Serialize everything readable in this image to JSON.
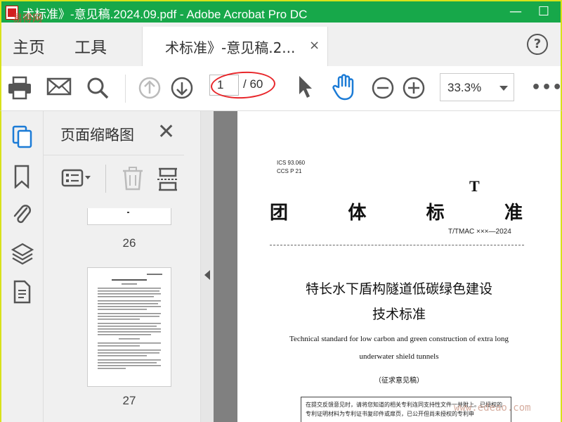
{
  "window": {
    "title": "术标准》-意见稿.2024.09.pdf - Adobe Acrobat Pro DC",
    "watermark_top": "易得网",
    "minimize": "—",
    "maximize": "☐"
  },
  "tabs": {
    "home": "主页",
    "tools": "工具",
    "document_tab": "术标准》-意见稿.2...",
    "close": "×",
    "help": "?"
  },
  "toolbar": {
    "current_page": "1",
    "total_pages": "/ 60",
    "zoom": "33.3%",
    "more": "•••"
  },
  "thumbnail_panel": {
    "title": "页面缩略图",
    "close": "✕",
    "pages": [
      {
        "label": "26"
      },
      {
        "label": "27"
      }
    ]
  },
  "document": {
    "ics": "ICS 93.060",
    "ccs": "CCS P 21",
    "t_letter": "T",
    "heading_chars": [
      "团",
      "体",
      "标",
      "准"
    ],
    "standard_no": "T/TMAC ×××—2024",
    "title_cn_line1": "特长水下盾构隧道低碳绿色建设",
    "title_cn_line2": "技术标准",
    "title_en_line1": "Technical standard for low carbon and green construction of extra long",
    "title_en_line2": "underwater shield tunnels",
    "draft_note": "（征求意见稿）",
    "notice_text": "在提交反馈意见时，请将您知道的相关专利连同支持性文件一并附上。已授权的专利证明材料为专利证书复印件或扉页，已公开但尚未授权的专利申"
  },
  "watermark_bottom": "www.edeao.com",
  "colors": {
    "titlebar": "#17a84a",
    "border_highlight": "#d8e21a",
    "annotation_red": "#e8262a",
    "hand_tool_blue": "#1b7bd6"
  }
}
